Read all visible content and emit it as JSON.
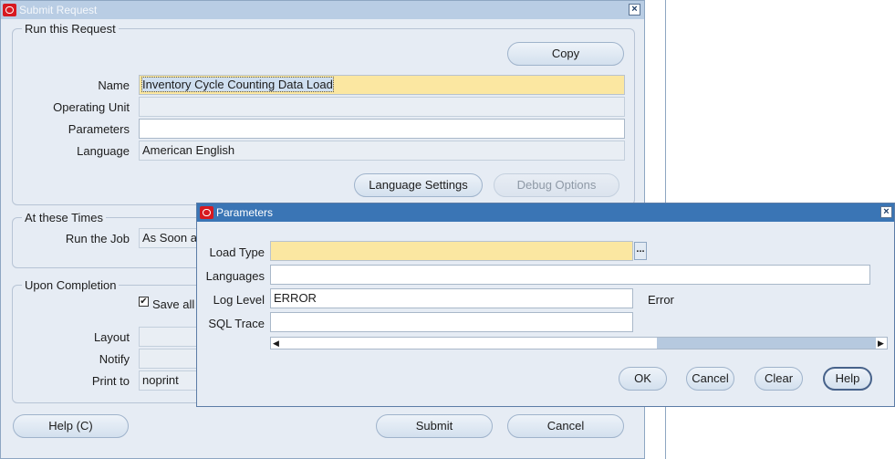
{
  "submit_request": {
    "title": "Submit Request",
    "close_glyph": "×",
    "run_group": {
      "title": "Run this Request",
      "copy_label": "Copy",
      "name_label": "Name",
      "name_value": "Inventory Cycle Counting Data Load",
      "operating_unit_label": "Operating Unit",
      "operating_unit_value": "",
      "parameters_label": "Parameters",
      "parameters_value": "",
      "language_label": "Language",
      "language_value": "American English",
      "language_settings_label": "Language Settings",
      "debug_options_label": "Debug Options"
    },
    "times_group": {
      "title": "At these Times",
      "run_job_label": "Run the Job",
      "run_job_value": "As Soon a"
    },
    "completion_group": {
      "title": "Upon Completion",
      "save_all_label": "Save all",
      "save_all_checked": true,
      "layout_label": "Layout",
      "layout_value": "",
      "notify_label": "Notify",
      "notify_value": "",
      "print_to_label": "Print to",
      "print_to_value": "noprint"
    },
    "help_label": "Help (C)",
    "submit_label": "Submit",
    "cancel_label": "Cancel"
  },
  "parameters": {
    "title": "Parameters",
    "close_glyph": "×",
    "load_type_label": "Load Type",
    "load_type_value": "",
    "lov_glyph": "...",
    "languages_label": "Languages",
    "languages_value": "",
    "log_level_label": "Log Level",
    "log_level_value": "ERROR",
    "log_level_desc": "Error",
    "sql_trace_label": "SQL Trace",
    "sql_trace_value": "",
    "scroll_left_glyph": "◀",
    "scroll_right_glyph": "▶",
    "ok_label": "OK",
    "cancel_label": "Cancel",
    "clear_label": "Clear",
    "help_label": "Help"
  },
  "colors": {
    "required_field": "#fbe7a1",
    "active_titlebar": "#3a75b5",
    "inactive_titlebar": "#b9cde4",
    "window_bg": "#e6ecf4"
  }
}
